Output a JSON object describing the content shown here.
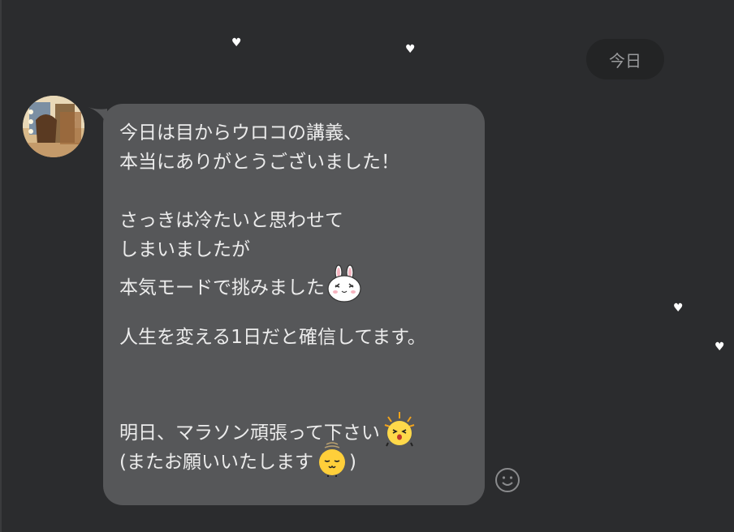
{
  "date_pill": {
    "label": "今日"
  },
  "message": {
    "lines": [
      "今日は目からウロコの講義、",
      "本当にありがとうございました！",
      "さっきは冷たいと思わせて",
      "しまいましたが",
      "本気モードで挑みました",
      "人生を変える1日だと確信してます。",
      "明日、マラソン頑張って下さい",
      "(またお願いいたします",
      ")"
    ],
    "emoji": [
      "rabbit-face-icon",
      "excited-chick-icon",
      "sleepy-chick-icon"
    ]
  },
  "avatar": {
    "icon": "user-avatar-photo"
  },
  "reaction": {
    "icon": "smiley-react-icon"
  },
  "colors": {
    "background": "#2b2c2e",
    "bubble": "#565759",
    "text": "#ececec",
    "date_pill_bg": "#232425",
    "date_pill_text": "#9a9b9d"
  }
}
